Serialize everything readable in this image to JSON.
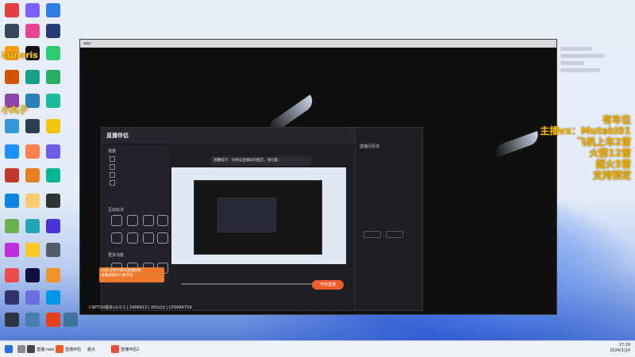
{
  "desktop": {
    "overlay_text": [
      "有车位",
      "主播vx：Muteki01",
      "飞机上车2窗",
      "火箭12窗",
      "超火5窗",
      "支持预定"
    ],
    "left_overlay": [
      "Lunaris",
      "小丸子"
    ],
    "colors": {
      "overlay": "#f3b400",
      "accent": "#f05c2a"
    }
  },
  "main_window": {
    "title": "app"
  },
  "obs": {
    "logo_text": "直播伴侣",
    "status_text": "CNPTO0版本v3.0.1 | 2408913 | 0f1b2d | CP0984759",
    "start_button": "开始直播",
    "notice": "温馨提示：为保证直播间的稳定，请尽量...",
    "orange_popup": [
      "以帧/分钟计算的直播数据",
      "直播间观众人数可见"
    ],
    "left_sections": {
      "scene": "场景",
      "tools": "互动玩法",
      "more": "更多功能"
    },
    "right_panel": {
      "header": "直播间互动"
    }
  },
  "taskbar": {
    "items": [
      "直播-new",
      "直播伴侣",
      "最大",
      "直播伴侣2"
    ],
    "time": "17:19",
    "date": "2024/1/24"
  }
}
